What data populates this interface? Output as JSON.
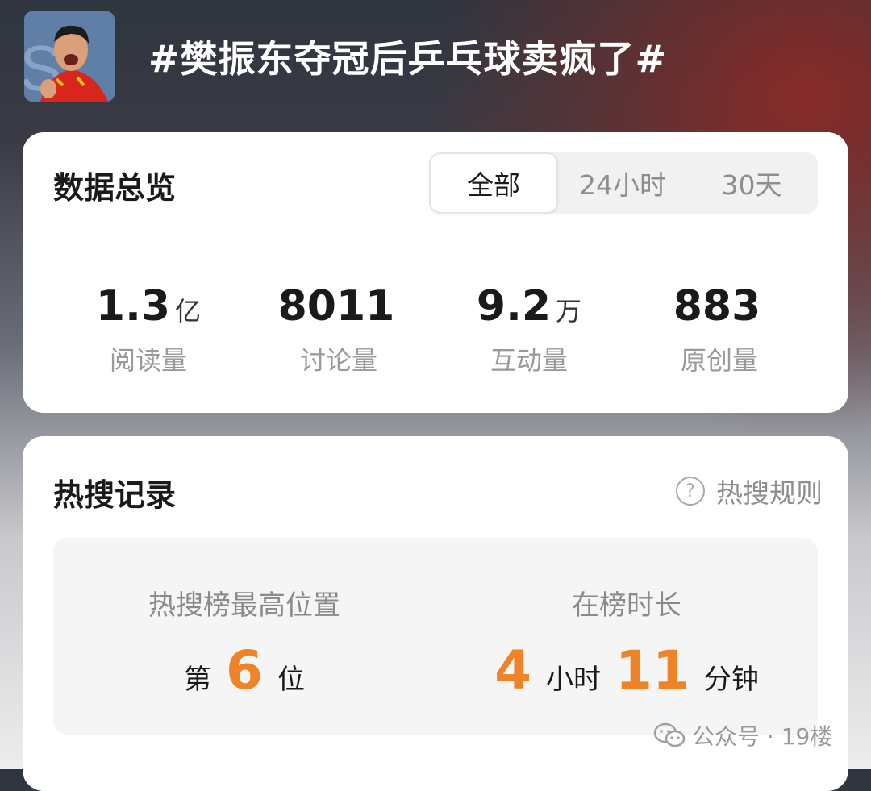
{
  "header": {
    "title": "#樊振东夺冠后乒乓球卖疯了#",
    "avatar_icon": "athlete-avatar"
  },
  "overview": {
    "title": "数据总览",
    "tabs": [
      {
        "label": "全部",
        "active": true
      },
      {
        "label": "24小时",
        "active": false
      },
      {
        "label": "30天",
        "active": false
      }
    ],
    "stats": [
      {
        "value": "1.3",
        "unit": "亿",
        "label": "阅读量"
      },
      {
        "value": "8011",
        "unit": "",
        "label": "讨论量"
      },
      {
        "value": "9.2",
        "unit": "万",
        "label": "互动量"
      },
      {
        "value": "883",
        "unit": "",
        "label": "原创量"
      }
    ]
  },
  "hot_search": {
    "title": "热搜记录",
    "rules_label": "热搜规则",
    "rules_icon": "question-circle-icon",
    "peak": {
      "label": "热搜榜最高位置",
      "prefix": "第",
      "value": "6",
      "suffix": "位"
    },
    "duration": {
      "label": "在榜时长",
      "hours": "4",
      "hours_unit": "小时",
      "minutes": "11",
      "minutes_unit": "分钟"
    }
  },
  "watermark": {
    "text": "公众号 · 19楼",
    "icon": "wechat-icon"
  },
  "colors": {
    "accent_orange": "#ee8328",
    "card_bg": "#ffffff",
    "muted_text": "#9a9a9a"
  }
}
